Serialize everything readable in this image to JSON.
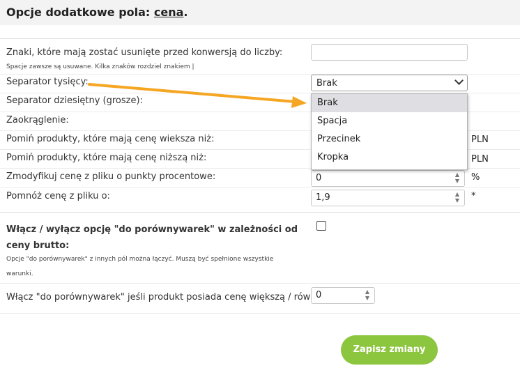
{
  "header": {
    "title_prefix": "Opcje dodatkowe pola: ",
    "field_name": "cena",
    "title_suffix": "."
  },
  "fields": {
    "remove_chars": {
      "label": "Znaki, które mają zostać usunięte przed konwersją do liczby:",
      "hint": "Spacje zawsze są usuwane. Kilka znaków rozdziel znakiem |",
      "value": ""
    },
    "thousands_sep": {
      "label": "Separator tysięcy:",
      "selected": "Brak",
      "options": [
        "Brak",
        "Spacja",
        "Przecinek",
        "Kropka"
      ]
    },
    "decimal_sep": {
      "label": "Separator dziesiętny (grosze):"
    },
    "rounding": {
      "label": "Zaokrąglenie:"
    },
    "skip_greater": {
      "label": "Pomiń produkty, które mają cenę wieksza niż:",
      "unit": "PLN"
    },
    "skip_lower": {
      "label": "Pomiń produkty, które mają cenę niższą niż:",
      "unit": "PLN"
    },
    "modify_percent": {
      "label": "Zmodyfikuj cenę z pliku o punkty procentowe:",
      "value": "0",
      "unit": "%"
    },
    "multiply": {
      "label": "Pomnóż cenę z pliku o:",
      "value": "1,9",
      "unit": "*"
    }
  },
  "comparison": {
    "title": "Włącz / wyłącz opcję \"do porównywarek\" w zależności od ceny brutto:",
    "hint": "Opcje \"do porównywarek\" z innych pól można łączyć. Muszą być spełnione wszystkie warunki.",
    "enabled": false,
    "price_label": "Włącz \"do porównywarek\" jeśli produkt posiada cenę większą / równą:",
    "price_value": "0"
  },
  "actions": {
    "save_label": "Zapisz zmiany"
  },
  "colors": {
    "save_button": "#8cc63f",
    "arrow": "#f5a623"
  },
  "icons": {
    "select_chevron": "chevron-down-icon",
    "spinner": "spinner-arrows-icon",
    "annotation": "arrow-icon"
  }
}
